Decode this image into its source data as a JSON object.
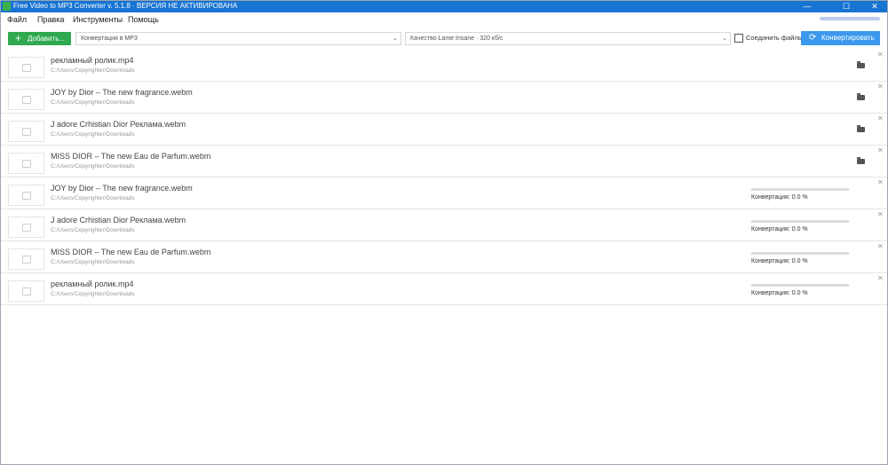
{
  "window": {
    "title": "Free Video to MP3 Converter v. 5.1.8 · ВЕРСИЯ НЕ АКТИВИРОВАНА",
    "minimize_glyph": "—",
    "maximize_glyph": "☐",
    "close_glyph": "✕"
  },
  "menu": {
    "items": [
      "Файл",
      "Правка",
      "Инструменты",
      "Помощь"
    ]
  },
  "toolbar": {
    "add_label": "Добавить...",
    "add_glyph": "+",
    "format_value": "Конвертация в MP3",
    "quality_value": "Качество Lame Insane · 320 кб/с",
    "chevron_glyph": "⌄",
    "join_label": "Соединить файлы",
    "join_checked": false,
    "convert_label": "Конвертировать",
    "convert_glyph": "⟳",
    "accent_green": "#2fa84f",
    "accent_blue": "#3c98ec"
  },
  "files": [
    {
      "name": "рекламный ролик.mp4",
      "path": "C:/Users/Copyrighter/Downloads",
      "status": ""
    },
    {
      "name": "JOY by Dior – The new fragrance.webm",
      "path": "C:/Users/Copyrighter/Downloads",
      "status": ""
    },
    {
      "name": "J adore Crhistian Dior Реклама.webm",
      "path": "C:/Users/Copyrighter/Downloads",
      "status": ""
    },
    {
      "name": "MISS DIOR – The new Eau de Parfum.webm",
      "path": "C:/Users/Copyrighter/Downloads",
      "status": ""
    },
    {
      "name": "JOY by Dior – The new fragrance.webm",
      "path": "C:/Users/Copyrighter/Downloads",
      "status": "Конвертация: 0.0 %",
      "progress": 0.0
    },
    {
      "name": "J adore Crhistian Dior Реклама.webm",
      "path": "C:/Users/Copyrighter/Downloads",
      "status": "Конвертация: 0.0 %",
      "progress": 0.0
    },
    {
      "name": "MISS DIOR – The new Eau de Parfum.webm",
      "path": "C:/Users/Copyrighter/Downloads",
      "status": "Конвертация: 0.0 %",
      "progress": 0.0
    },
    {
      "name": "рекламный ролик.mp4",
      "path": "C:/Users/Copyrighter/Downloads",
      "status": "Конвертация: 0.0 %",
      "progress": 0.0
    }
  ],
  "row_glyphs": {
    "close": "✕"
  }
}
